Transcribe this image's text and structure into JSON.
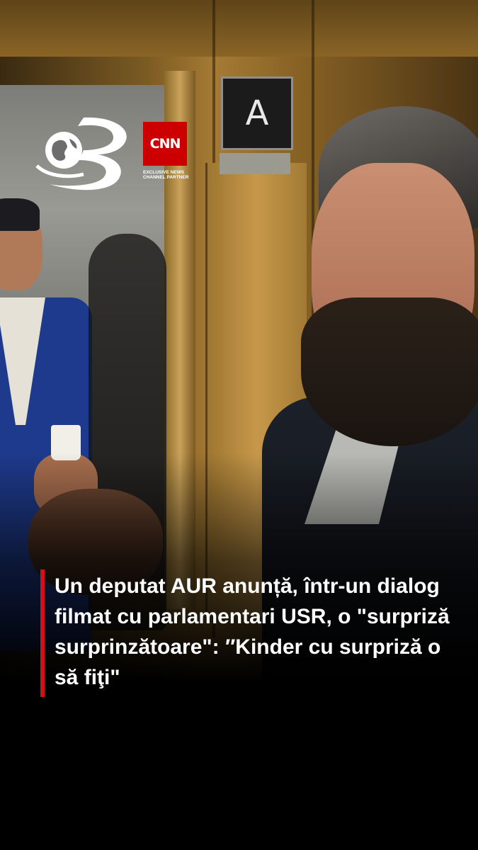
{
  "video": {
    "elevator_sign": "A"
  },
  "brand": {
    "channel_logo": "Antena 3 logo (stylized 3 with globe)",
    "cnn_label": "CNN",
    "partner_text": "EXCLUSIVE NEWS CHANNEL PARTNER"
  },
  "caption": {
    "headline": "Un deputat AUR anunță, într-un dialog filmat cu parlamentari USR, o \"surpriză surprinzătoare\": ″Kinder cu surpriză o să fiţi\""
  },
  "colors": {
    "accent_bar": "#d40f1c",
    "cnn_red": "#cc0000",
    "background": "#000000"
  }
}
